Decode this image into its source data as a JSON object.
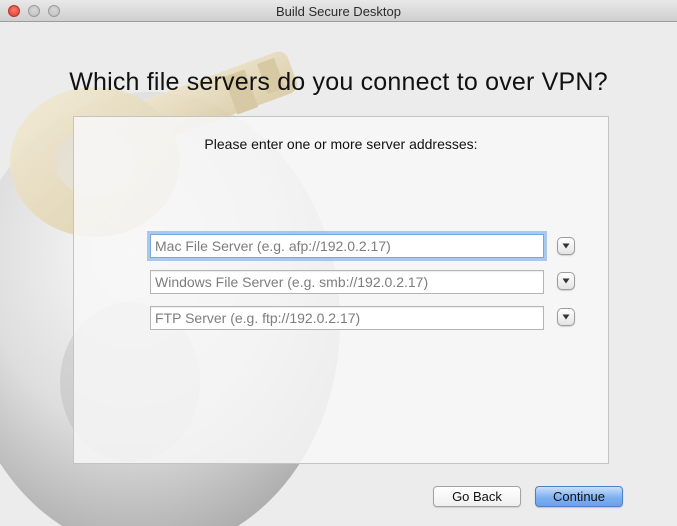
{
  "window": {
    "title": "Build Secure Desktop"
  },
  "heading": "Which file servers do you connect to over VPN?",
  "panel": {
    "prompt": "Please enter one or more server addresses:"
  },
  "fields": [
    {
      "value": "",
      "placeholder": "Mac File Server (e.g. afp://192.0.2.17)",
      "focused": true
    },
    {
      "value": "",
      "placeholder": "Windows File Server (e.g. smb://192.0.2.17)",
      "focused": false
    },
    {
      "value": "",
      "placeholder": "FTP Server (e.g. ftp://192.0.2.17)",
      "focused": false
    }
  ],
  "buttons": {
    "back": "Go Back",
    "continue": "Continue"
  },
  "icons": {
    "traffic_lights": [
      "close-icon",
      "minimize-icon",
      "zoom-icon"
    ],
    "dropdown": "chevron-down-icon",
    "background": "key-lock-icon"
  },
  "colors": {
    "default_button": "#6aa2ea",
    "focus_ring": "#6ca0e6",
    "close_light": "#d8392c"
  }
}
